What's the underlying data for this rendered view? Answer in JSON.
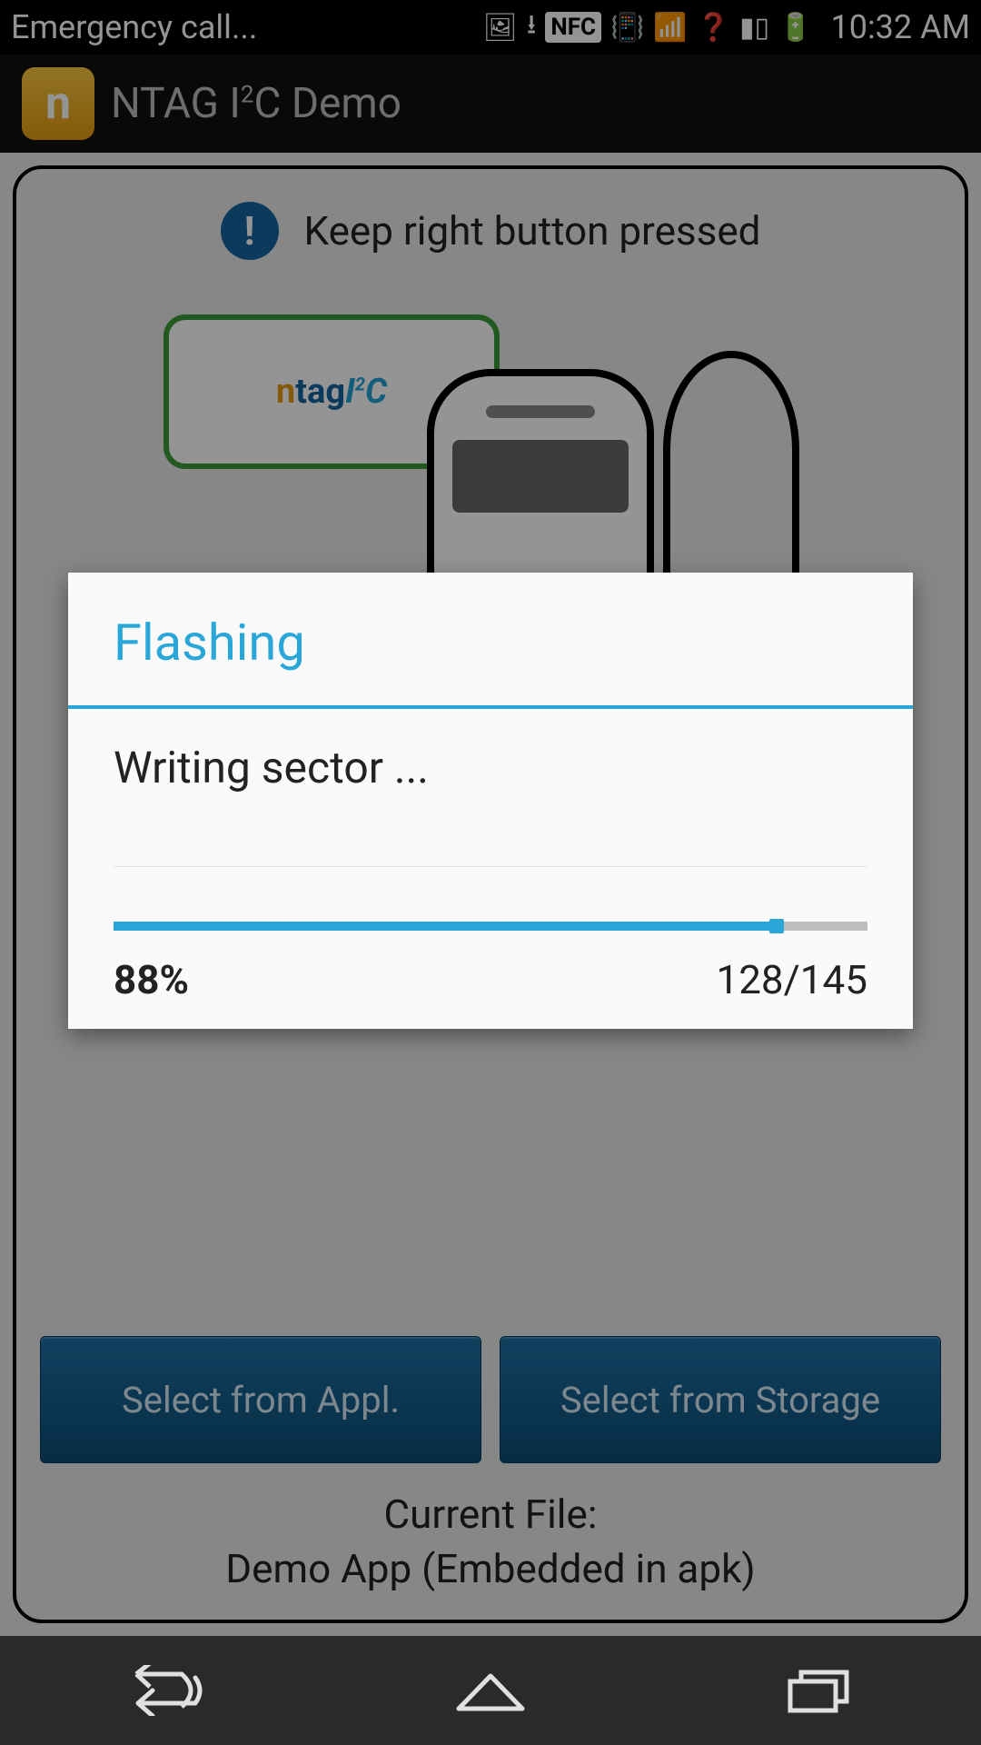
{
  "status": {
    "left_text": "Emergency call...",
    "time": "10:32 AM",
    "icons": {
      "nfc_label": "NFC"
    }
  },
  "app": {
    "title_prefix": "NTAG I",
    "title_sup": "2",
    "title_suffix": "C Demo"
  },
  "hint": {
    "text": "Keep right button pressed"
  },
  "illustration": {
    "tag_label_n": "n",
    "tag_label_tag": "tag",
    "tag_label_i": "I",
    "tag_label_sup": "2",
    "tag_label_c": "C"
  },
  "buttons": {
    "select_appl": "Select from Appl.",
    "select_storage": "Select from Storage"
  },
  "file": {
    "label": "Current File:",
    "name": "Demo App (Embedded in apk)"
  },
  "dialog": {
    "title": "Flashing",
    "message": "Writing sector ...",
    "percent_label": "88%",
    "percent": 88,
    "count_label": "128/145"
  }
}
